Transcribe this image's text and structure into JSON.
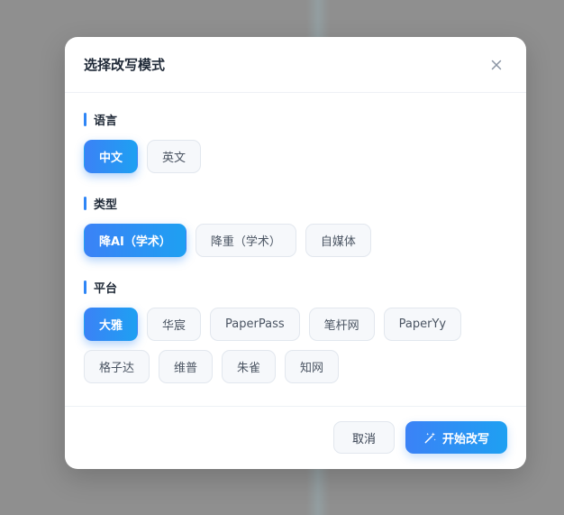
{
  "dialog": {
    "title": "选择改写模式",
    "close_icon": "close-icon"
  },
  "sections": {
    "language": {
      "label": "语言",
      "options": [
        "中文",
        "英文"
      ],
      "selected": "中文"
    },
    "type": {
      "label": "类型",
      "options": [
        "降AI（学术）",
        "降重（学术）",
        "自媒体"
      ],
      "selected": "降AI（学术）"
    },
    "platform": {
      "label": "平台",
      "options": [
        "大雅",
        "华宸",
        "PaperPass",
        "笔杆网",
        "PaperYy",
        "格子达",
        "维普",
        "朱雀",
        "知网"
      ],
      "selected": "大雅"
    }
  },
  "footer": {
    "cancel_label": "取消",
    "confirm_label": "开始改写",
    "confirm_icon": "magic-wand-icon"
  },
  "colors": {
    "accent_start": "#3b82f6",
    "accent_end": "#1ea0f2",
    "section_bar": "#2f86f6"
  }
}
